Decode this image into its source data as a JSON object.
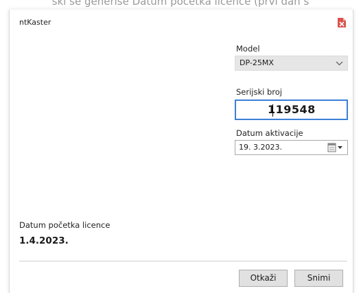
{
  "caption": "ski se generiše Datum početka licence (prvi dan s",
  "window": {
    "title": "ntKaster",
    "close_icon": "close-icon"
  },
  "form": {
    "model": {
      "label": "Model",
      "value": "DP-25MX"
    },
    "serial": {
      "label": "Serijski broj",
      "value": "119548"
    },
    "activation": {
      "label": "Datum aktivacije",
      "value": "19.  3.2023."
    },
    "license_start": {
      "label": "Datum početka licence",
      "value": "1.4.2023."
    }
  },
  "buttons": {
    "cancel": "Otkaži",
    "save": "Snimi"
  },
  "colors": {
    "focus_border": "#3a7fd5",
    "close_icon": "#d9534f"
  }
}
